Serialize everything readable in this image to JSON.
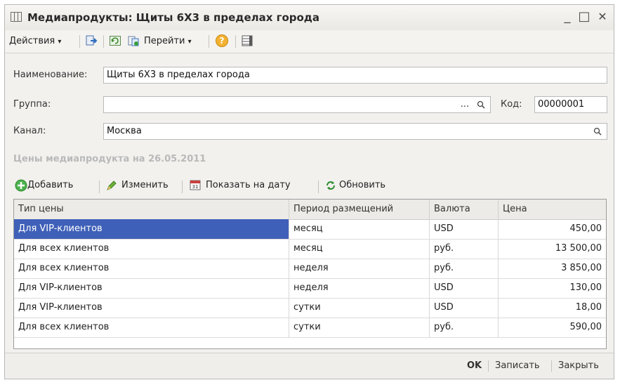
{
  "window": {
    "title": "Медиапродукты: Щиты 6Х3 в пределах города",
    "controls": {
      "minimize": "_",
      "maximize": "□",
      "close": "✕"
    }
  },
  "toolbar": {
    "actions_label": "Действия",
    "goto_label": "Перейти",
    "help_glyph": "?",
    "dropdown_glyph": "▾"
  },
  "form": {
    "name_label": "Наименование:",
    "name_value": "Щиты 6Х3 в пределах города",
    "group_label": "Группа:",
    "group_value": "",
    "group_dots": "...",
    "code_label": "Код:",
    "code_value": "00000001",
    "channel_label": "Канал:",
    "channel_value": "Москва"
  },
  "prices": {
    "section_title": "Цены медиапродукта на 26.05.2011",
    "add_label": "Добавить",
    "edit_label": "Изменить",
    "show_date_label": "Показать на дату",
    "refresh_label": "Обновить",
    "columns": [
      "Тип цены",
      "Период размещений",
      "Валюта",
      "Цена"
    ],
    "rows": [
      {
        "type": "Для VIP-клиентов",
        "period": "месяц",
        "currency": "USD",
        "price": "450,00"
      },
      {
        "type": "Для всех клиентов",
        "period": "месяц",
        "currency": "руб.",
        "price": "13 500,00"
      },
      {
        "type": "Для всех клиентов",
        "period": "неделя",
        "currency": "руб.",
        "price": "3 850,00"
      },
      {
        "type": "Для VIP-клиентов",
        "period": "неделя",
        "currency": "USD",
        "price": "130,00"
      },
      {
        "type": "Для VIP-клиентов",
        "period": "сутки",
        "currency": "USD",
        "price": "18,00"
      },
      {
        "type": "Для всех клиентов",
        "period": "сутки",
        "currency": "руб.",
        "price": "590,00"
      }
    ]
  },
  "footer": {
    "ok_label": "OK",
    "save_label": "Записать",
    "close_label": "Закрыть"
  },
  "colors": {
    "selection": "#3f60b8",
    "add_icon": "#3aa03a",
    "refresh_icon": "#2b8a2b",
    "help_icon": "#f0a020"
  }
}
